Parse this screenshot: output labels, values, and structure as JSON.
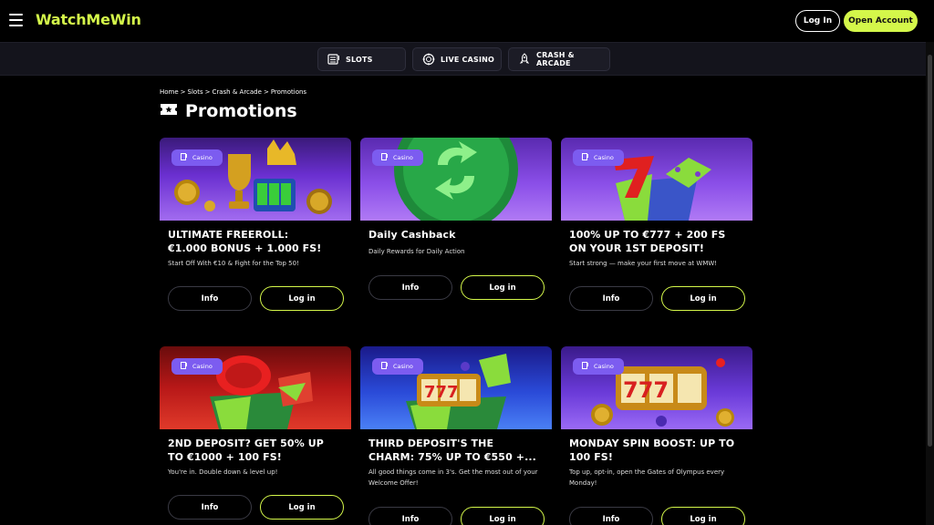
{
  "header": {
    "logo": "WatchMeWin",
    "login": "Log In",
    "open_account": "Open Account",
    "accent_color": "#d4f74a"
  },
  "categories": [
    {
      "label": "SLOTS",
      "icon": "slot-machine-icon"
    },
    {
      "label": "LIVE CASINO",
      "icon": "roulette-chip-icon"
    },
    {
      "label": "CRASH & ARCADE",
      "icon": "rocket-icon"
    }
  ],
  "breadcrumb": [
    "Home",
    ">",
    "Slots",
    ">",
    "Crash & Arcade",
    ">",
    "Promotions"
  ],
  "page_title": "Promotions",
  "cards": [
    {
      "badge": "Casino",
      "title_lines": [
        "ULTIMATE FREEROLL:",
        "€1.000 BONUS + 1.000 FS!"
      ],
      "desc": "Start Off With €10 & Fight for the Top 50!",
      "info": "Info",
      "login": "Log in"
    },
    {
      "badge": "Casino",
      "title_lines": [
        "Daily Cashback"
      ],
      "desc": "Daily Rewards for Daily Action",
      "info": "Info",
      "login": "Log in"
    },
    {
      "badge": "Casino",
      "title_lines": [
        "100% UP TO €777 + 200 FS",
        "ON YOUR 1ST DEPOSIT!"
      ],
      "desc": "Start strong — make your first move at WMW!",
      "info": "Info",
      "login": "Log in"
    },
    {
      "badge": "Casino",
      "title_lines": [
        "2ND DEPOSIT? GET 50% UP",
        "TO €1000 + 100 FS!"
      ],
      "desc": "You're in. Double down & level up!",
      "info": "Info",
      "login": "Log in"
    },
    {
      "badge": "Casino",
      "title_lines": [
        "THIRD DEPOSIT'S THE",
        "CHARM: 75% UP TO €550 +..."
      ],
      "desc": "All good things come in 3's. Get the most out of your Welcome Offer!",
      "info": "Info",
      "login": "Log in"
    },
    {
      "badge": "Casino",
      "title_lines": [
        "MONDAY SPIN BOOST: UP TO",
        "100 FS!"
      ],
      "desc": "Top up, opt-in, open the Gates of Olympus every Monday!",
      "info": "Info",
      "login": "Log in"
    }
  ]
}
